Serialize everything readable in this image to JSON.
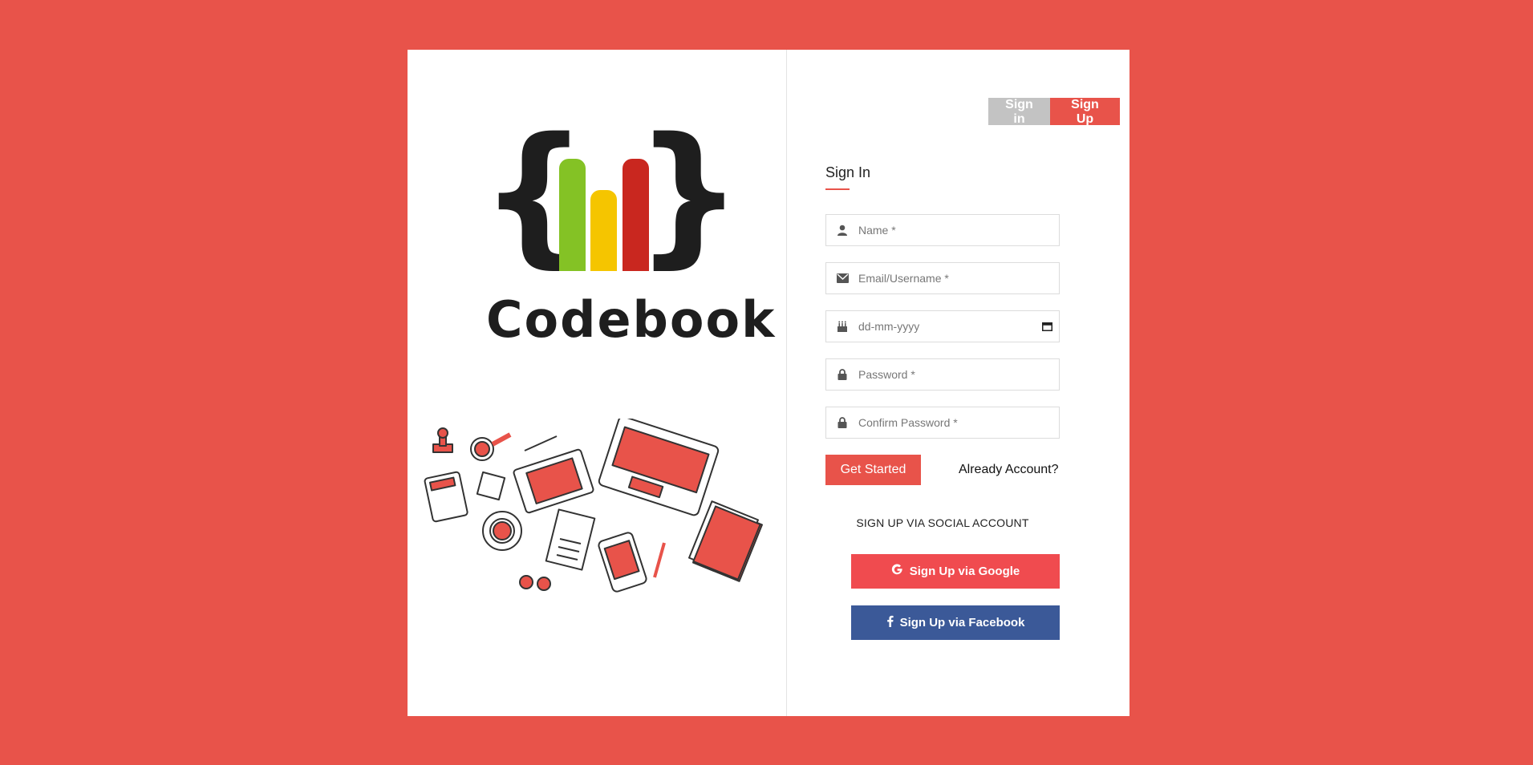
{
  "toggle": {
    "signin_label": "Sign in",
    "signup_label": "Sign Up"
  },
  "logo": {
    "wordmark": "Codebook"
  },
  "form": {
    "title": "Sign In",
    "fields": {
      "name_placeholder": "Name *",
      "email_placeholder": "Email/Username *",
      "date_placeholder": "dd-mm-yyyy",
      "password_placeholder": "Password *",
      "confirm_placeholder": "Confirm Password *"
    },
    "submit_label": "Get Started",
    "already_label": "Already Account?"
  },
  "social": {
    "heading": "SIGN UP VIA SOCIAL ACCOUNT",
    "google_label": "Sign Up via Google",
    "facebook_label": "Sign Up via Facebook"
  },
  "colors": {
    "background": "#e8534a",
    "accent": "#e8534a",
    "google": "#f04b4f",
    "facebook": "#3b5998",
    "toggle_inactive": "#c3c3c3"
  }
}
